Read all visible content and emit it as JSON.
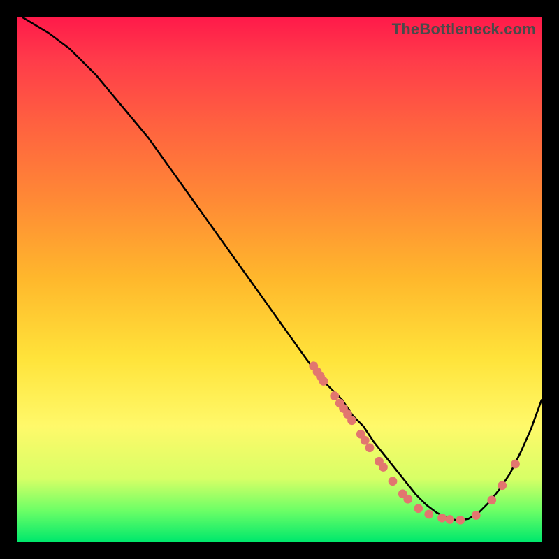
{
  "watermark": "TheBottleneck.com",
  "chart_data": {
    "type": "line",
    "title": "",
    "xlabel": "",
    "ylabel": "",
    "xlim": [
      0,
      100
    ],
    "ylim": [
      0,
      100
    ],
    "series": [
      {
        "name": "curve",
        "x": [
          1,
          6,
          10,
          15,
          20,
          25,
          30,
          35,
          40,
          45,
          50,
          55,
          58,
          60,
          62,
          64,
          66,
          68,
          70,
          72,
          74,
          76,
          78,
          80,
          82,
          84,
          86,
          88,
          90,
          92,
          94,
          96,
          98,
          100
        ],
        "y": [
          100,
          97,
          94,
          89,
          83,
          77,
          70,
          63,
          56,
          49,
          42,
          35,
          31,
          29,
          27,
          24,
          22,
          19,
          16.5,
          14,
          11.5,
          9,
          7,
          5.5,
          4.5,
          4,
          4.3,
          5.5,
          7.5,
          10,
          13,
          17,
          21.5,
          27
        ]
      }
    ],
    "points": [
      {
        "x": 56.5,
        "y": 33.5
      },
      {
        "x": 57.2,
        "y": 32.4
      },
      {
        "x": 57.8,
        "y": 31.5
      },
      {
        "x": 58.4,
        "y": 30.6
      },
      {
        "x": 60.5,
        "y": 27.8
      },
      {
        "x": 61.5,
        "y": 26.4
      },
      {
        "x": 62.2,
        "y": 25.4
      },
      {
        "x": 63.0,
        "y": 24.3
      },
      {
        "x": 63.8,
        "y": 23.1
      },
      {
        "x": 65.5,
        "y": 20.5
      },
      {
        "x": 66.3,
        "y": 19.3
      },
      {
        "x": 67.2,
        "y": 17.9
      },
      {
        "x": 69.0,
        "y": 15.3
      },
      {
        "x": 69.8,
        "y": 14.2
      },
      {
        "x": 71.6,
        "y": 11.5
      },
      {
        "x": 73.5,
        "y": 9.1
      },
      {
        "x": 74.5,
        "y": 8.1
      },
      {
        "x": 76.5,
        "y": 6.3
      },
      {
        "x": 78.5,
        "y": 5.2
      },
      {
        "x": 81.0,
        "y": 4.5
      },
      {
        "x": 82.5,
        "y": 4.2
      },
      {
        "x": 84.5,
        "y": 4.1
      },
      {
        "x": 87.5,
        "y": 5.0
      },
      {
        "x": 90.5,
        "y": 7.9
      },
      {
        "x": 92.5,
        "y": 10.7
      },
      {
        "x": 95.0,
        "y": 14.8
      }
    ],
    "point_color": "#e2766f",
    "line_color": "#000000"
  }
}
